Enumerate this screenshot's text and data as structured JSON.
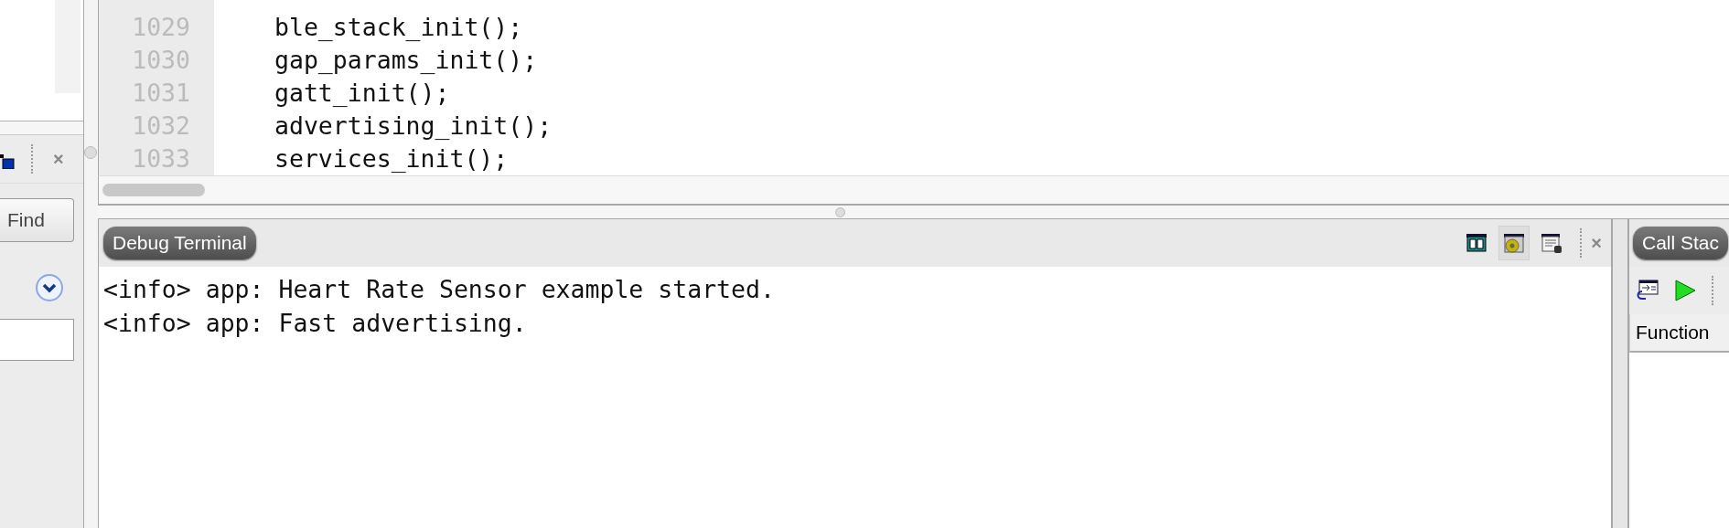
{
  "left_panel": {
    "close": "×",
    "find_button": "Find"
  },
  "editor": {
    "lines": [
      {
        "number": "1029",
        "text": "ble_stack_init();"
      },
      {
        "number": "1030",
        "text": "gap_params_init();"
      },
      {
        "number": "1031",
        "text": "gatt_init();"
      },
      {
        "number": "1032",
        "text": "advertising_init();"
      },
      {
        "number": "1033",
        "text": "services_init();"
      }
    ]
  },
  "debug_terminal": {
    "title": "Debug Terminal",
    "close": "×",
    "toolbar": [
      {
        "kind": "book",
        "selected": false
      },
      {
        "kind": "gear",
        "selected": true
      },
      {
        "kind": "list",
        "selected": false
      }
    ],
    "lines": [
      "<info> app: Heart Rate Sensor example started.",
      "<info> app: Fast advertising."
    ]
  },
  "call_stack": {
    "title": "Call Stac",
    "columns": [
      "Function"
    ]
  }
}
